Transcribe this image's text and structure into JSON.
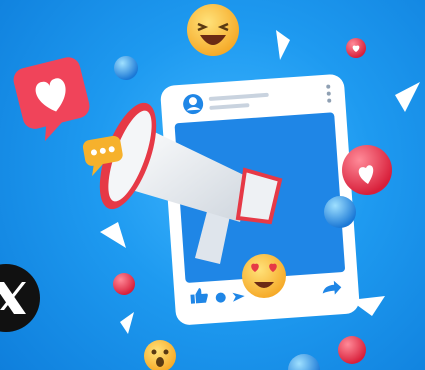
{
  "scene": {
    "description_free": true,
    "colors": {
      "background": "#1e9af0",
      "card": "#ffffff",
      "card_photo": "#1f86e6",
      "megaphone": "#f2f2f2",
      "megaphone_rim": "#e63946",
      "heart_bubble": "#f0445a",
      "emoji": "#ffc83d",
      "x_logo_bg": "#111111"
    },
    "icons": [
      "megaphone-icon",
      "social-post-card",
      "heart-bubble-icon",
      "chat-bubble-icon",
      "laughing-emoji-icon",
      "heart-eyes-emoji-icon",
      "surprised-emoji-icon",
      "like-thumb-icon",
      "comment-icon",
      "send-icon",
      "share-arrow-icon",
      "x-logo-icon",
      "avatar-icon",
      "more-options-icon"
    ]
  }
}
